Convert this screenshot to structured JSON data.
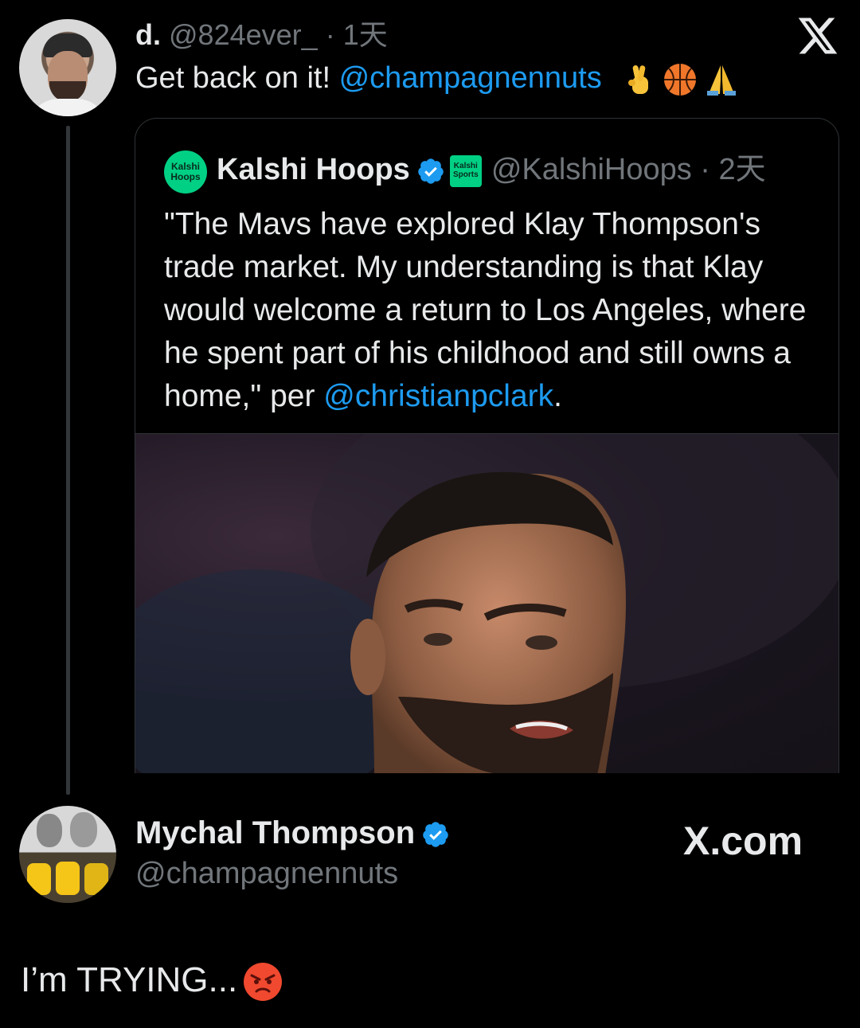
{
  "top_tweet": {
    "display_name": "d.",
    "handle": "@824ever_",
    "time": "· 1天",
    "text_prefix": "Get back on it! ",
    "mention": "@champagnennuts",
    "emojis": [
      "crossed-fingers-icon",
      "basketball-icon",
      "folded-hands-icon"
    ]
  },
  "quoted_tweet": {
    "avatar_text_line1": "Kalshi",
    "avatar_text_line2": "Hoops",
    "display_name": "Kalshi Hoops",
    "affiliate_line1": "Kalshi",
    "affiliate_line2": "Sports",
    "handle": "@KalshiHoops",
    "time": "· 2天",
    "text": "\"The Mavs have explored Klay Thompson's trade market. My understanding is that Klay would welcome a return to Los Angeles, where he spent part of his childhood and still owns a home,\" per ",
    "mention": "@christianpclark",
    "text_suffix": "."
  },
  "reply": {
    "display_name": "Mychal Thompson",
    "handle": "@champagnennuts",
    "text": "I’m TRYING..."
  },
  "watermark": "X.com",
  "colors": {
    "background": "#000000",
    "text": "#e7e9ea",
    "secondary": "#71767b",
    "link": "#1d9bf0",
    "verified": "#1d9bf0",
    "kalshi_green": "#00d084"
  }
}
